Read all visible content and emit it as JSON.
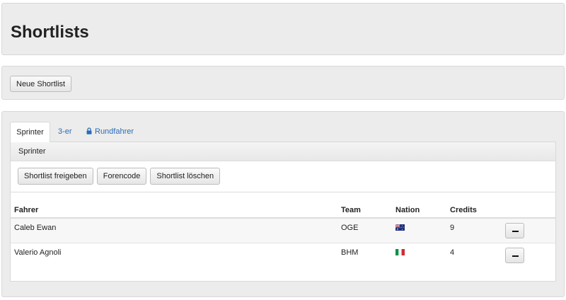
{
  "page": {
    "title": "Shortlists"
  },
  "actions": {
    "new_shortlist": "Neue Shortlist"
  },
  "tabs": [
    {
      "label": "Sprinter",
      "active": true,
      "locked": false
    },
    {
      "label": "3-er",
      "active": false,
      "locked": false
    },
    {
      "label": "Rundfahrer",
      "active": false,
      "locked": true,
      "icon": "lock-icon"
    }
  ],
  "shortlist": {
    "name": "Sprinter",
    "buttons": {
      "release": "Shortlist freigeben",
      "forum_code": "Forencode",
      "delete": "Shortlist löschen"
    }
  },
  "table": {
    "headers": {
      "rider": "Fahrer",
      "team": "Team",
      "nation": "Nation",
      "credits": "Credits"
    },
    "rows": [
      {
        "rider": "Caleb Ewan",
        "team": "OGE",
        "nation_flag": "australia-flag",
        "credits": "9"
      },
      {
        "rider": "Valerio Agnoli",
        "team": "BHM",
        "nation_flag": "italy-flag",
        "credits": "4"
      }
    ]
  },
  "colors": {
    "link": "#2a6db5",
    "panel": "#ececec"
  }
}
